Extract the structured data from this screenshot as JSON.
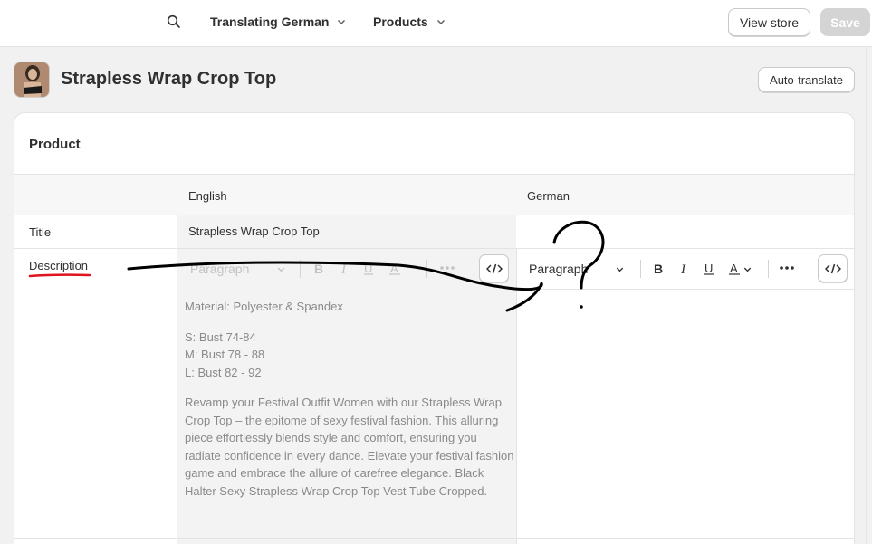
{
  "topbar": {
    "translating": "Translating German",
    "products": "Products",
    "view_store": "View store",
    "save": "Save"
  },
  "page": {
    "title": "Strapless Wrap Crop Top",
    "auto_translate": "Auto-translate"
  },
  "card": {
    "title": "Product",
    "source_language": "English",
    "target_language": "German",
    "rows": {
      "title_label": "Title",
      "title_english": "Strapless Wrap Crop Top",
      "description_label": "Description"
    },
    "toolbar": {
      "source_format": "Paragraph",
      "target_format": "Paragraph"
    },
    "description_english": {
      "p1": "Material: Polyester & Spandex",
      "sizes": [
        "S: Bust 74-84",
        "M: Bust 78 - 88",
        "L: Bust 82 - 92"
      ],
      "p3": "Revamp your Festival Outfit Women with our Strapless Wrap Crop Top – the epitome of sexy festival fashion. This alluring piece effortlessly blends style and comfort, ensuring you radiate confidence in every dance. Elevate your festival fashion game and embrace the allure of carefree elegance. Black Halter Sexy Strapless Wrap Crop Top Vest Tube Cropped."
    }
  },
  "icons": {
    "search": "search-icon",
    "chevron": "chevron-down-icon",
    "bold": "bold-icon",
    "italic": "italic-icon",
    "underline": "underline-icon",
    "text_color": "text-color-icon",
    "more": "more-horizontal-icon",
    "code": "code-icon"
  },
  "colors": {
    "annotation_ink": "#000000",
    "annotation_red": "#e0141e",
    "save_disabled": "#d4d4d4"
  }
}
